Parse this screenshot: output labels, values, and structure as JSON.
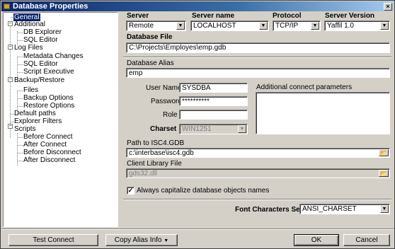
{
  "window": {
    "title": "Database Properties",
    "close_glyph": "×"
  },
  "tree": {
    "items": [
      {
        "label": "General",
        "selected": true
      },
      {
        "label": "Additional"
      },
      {
        "label": "DB Explorer"
      },
      {
        "label": "SQL Editor"
      },
      {
        "label": "Log Files"
      },
      {
        "label": "Metadata Changes"
      },
      {
        "label": "SQL Editor"
      },
      {
        "label": "Script Executive"
      },
      {
        "label": "Backup/Restore"
      },
      {
        "label": "Files"
      },
      {
        "label": "Backup Options"
      },
      {
        "label": "Restore Options"
      },
      {
        "label": "Default paths"
      },
      {
        "label": "Explorer Filters"
      },
      {
        "label": "Scripts"
      },
      {
        "label": "Before Connect"
      },
      {
        "label": "After Connect"
      },
      {
        "label": "Before Disconnect"
      },
      {
        "label": "After Disconnect"
      }
    ],
    "collapse_glyph": "−"
  },
  "server": {
    "label": "Server",
    "value": "Remote",
    "name_label": "Server name",
    "name_value": "LOCALHOST",
    "protocol_label": "Protocol",
    "protocol_value": "TCP/IP",
    "version_label": "Server Version",
    "version_value": "Yaffil 1.0"
  },
  "database_file": {
    "label": "Database File",
    "value": "C:\\Projects\\Employes\\emp.gdb"
  },
  "alias": {
    "label": "Database Alias",
    "value": "emp"
  },
  "credentials": {
    "user_label": "User Name",
    "user_value": "SYSDBA",
    "password_label": "Password",
    "password_value": "**********",
    "role_label": "Role",
    "role_value": "",
    "charset_label": "Charset",
    "charset_value": "WIN1251"
  },
  "additional_params": {
    "label": "Additional connect parameters",
    "value": ""
  },
  "isc4": {
    "label": "Path to ISC4.GDB",
    "value": "c:\\interbase\\isc4.gdb"
  },
  "client_lib": {
    "label": "Client Library File",
    "value": "gds32.dll"
  },
  "capitalize": {
    "label": "Always capitalize database objects names",
    "checked": true,
    "check_glyph": "✓"
  },
  "font_charset": {
    "label": "Font Characters Set",
    "value": "ANSI_CHARSET"
  },
  "buttons": {
    "test_connect": "Test Connect",
    "copy_alias": "Copy Alias Info",
    "ok": "OK",
    "cancel": "Cancel"
  },
  "glyphs": {
    "dropdown": "▼",
    "folder": "📂"
  }
}
